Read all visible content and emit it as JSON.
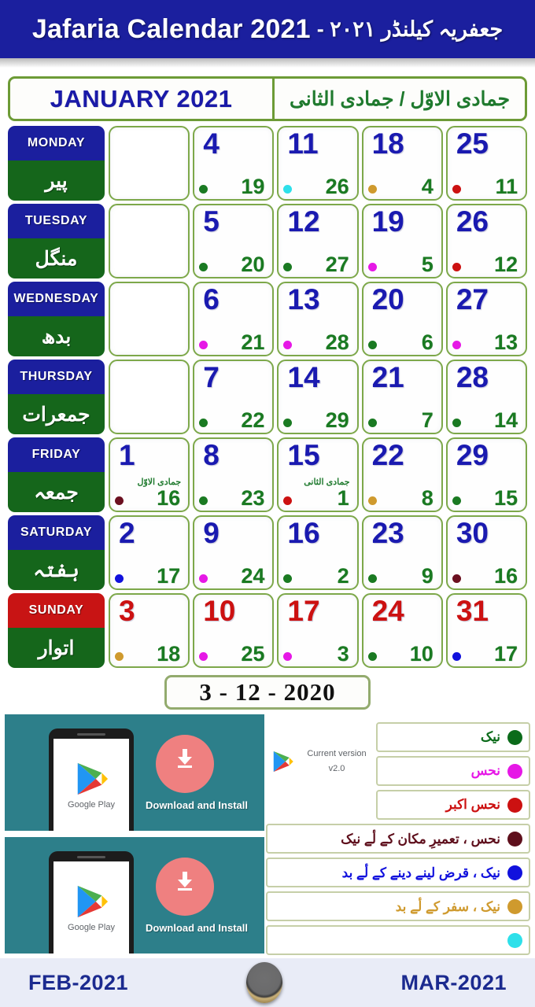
{
  "app": {
    "title_en": "Jafaria Calendar 2021",
    "title_ur": "جعفریہ کیلنڈر ۲۰۲۱ -"
  },
  "month_header": {
    "gregorian": "JANUARY 2021",
    "hijri": "جمادى الاوّل / جمادى الثانى"
  },
  "days": [
    {
      "en": "MONDAY",
      "ur": "پیر"
    },
    {
      "en": "TUESDAY",
      "ur": "منگل"
    },
    {
      "en": "WEDNESDAY",
      "ur": "بدھ"
    },
    {
      "en": "THURSDAY",
      "ur": "جمعرات"
    },
    {
      "en": "FRIDAY",
      "ur": "جمعہ"
    },
    {
      "en": "SATURDAY",
      "ur": "ہفتہ"
    },
    {
      "en": "SUNDAY",
      "ur": "اتوار"
    }
  ],
  "colors": {
    "title_bar": "#1b1f9e",
    "day_en_bg": "#1b1f9e",
    "day_en_sunday_bg": "#c81414",
    "day_ur_bg": "#15661b",
    "cell_border": "#7da84a",
    "gregorian_num": "#1a1ab0",
    "sunday_num": "#cc1111",
    "hijri_num": "#1a7a22",
    "banner_bg": "#2d7f8a",
    "bottom_nav_bg": "#e9ecf7"
  },
  "weeks": [
    {
      "day": "MONDAY",
      "cells": [
        {
          "empty": true
        },
        {
          "g": "4",
          "h": "19",
          "dot": "#1a7a22"
        },
        {
          "g": "11",
          "h": "26",
          "dot": "#2ee0ea"
        },
        {
          "g": "18",
          "h": "4",
          "dot": "#cf9a2e"
        },
        {
          "g": "25",
          "h": "11",
          "dot": "#cc1111"
        }
      ]
    },
    {
      "day": "TUESDAY",
      "cells": [
        {
          "empty": true
        },
        {
          "g": "5",
          "h": "20",
          "dot": "#1a7a22"
        },
        {
          "g": "12",
          "h": "27",
          "dot": "#1a7a22"
        },
        {
          "g": "19",
          "h": "5",
          "dot": "#e618e6"
        },
        {
          "g": "26",
          "h": "12",
          "dot": "#cc1111"
        }
      ]
    },
    {
      "day": "WEDNESDAY",
      "cells": [
        {
          "empty": true
        },
        {
          "g": "6",
          "h": "21",
          "dot": "#e618e6"
        },
        {
          "g": "13",
          "h": "28",
          "dot": "#e618e6"
        },
        {
          "g": "20",
          "h": "6",
          "dot": "#1a7a22"
        },
        {
          "g": "27",
          "h": "13",
          "dot": "#e618e6"
        }
      ]
    },
    {
      "day": "THURSDAY",
      "cells": [
        {
          "empty": true
        },
        {
          "g": "7",
          "h": "22",
          "dot": "#1a7a22"
        },
        {
          "g": "14",
          "h": "29",
          "dot": "#1a7a22"
        },
        {
          "g": "21",
          "h": "7",
          "dot": "#1a7a22"
        },
        {
          "g": "28",
          "h": "14",
          "dot": "#1a7a22"
        }
      ]
    },
    {
      "day": "FRIDAY",
      "cells": [
        {
          "g": "1",
          "h": "16",
          "dot": "#6b1020",
          "hmonth": "جمادى الاوّل"
        },
        {
          "g": "8",
          "h": "23",
          "dot": "#1a7a22"
        },
        {
          "g": "15",
          "h": "1",
          "dot": "#cc1111",
          "hmonth": "جمادى الثانى"
        },
        {
          "g": "22",
          "h": "8",
          "dot": "#cf9a2e"
        },
        {
          "g": "29",
          "h": "15",
          "dot": "#1a7a22"
        }
      ]
    },
    {
      "day": "SATURDAY",
      "cells": [
        {
          "g": "2",
          "h": "17",
          "dot": "#1111dd"
        },
        {
          "g": "9",
          "h": "24",
          "dot": "#e618e6"
        },
        {
          "g": "16",
          "h": "2",
          "dot": "#1a7a22"
        },
        {
          "g": "23",
          "h": "9",
          "dot": "#1a7a22"
        },
        {
          "g": "30",
          "h": "16",
          "dot": "#6b1020"
        }
      ]
    },
    {
      "day": "SUNDAY",
      "sunday": true,
      "cells": [
        {
          "g": "3",
          "h": "18",
          "dot": "#cf9a2e"
        },
        {
          "g": "10",
          "h": "25",
          "dot": "#e618e6"
        },
        {
          "g": "17",
          "h": "3",
          "dot": "#e618e6"
        },
        {
          "g": "24",
          "h": "10",
          "dot": "#1a7a22"
        },
        {
          "g": "31",
          "h": "17",
          "dot": "#1111dd"
        }
      ]
    }
  ],
  "today_box": "3 - 12 - 2020",
  "banner": {
    "gplay_label": "Google Play",
    "cta": "Download and Install"
  },
  "version": {
    "line1": "Current version",
    "line2": "v2.0"
  },
  "legend": [
    {
      "label": "نیک",
      "dot": "#0b6b1a",
      "text_color": "#0b6b1a",
      "size": "short"
    },
    {
      "label": "نحس",
      "dot": "#e618e6",
      "text_color": "#e618e6",
      "size": "short"
    },
    {
      "label": "نحس اکبر",
      "dot": "#cc1111",
      "text_color": "#cc1111",
      "size": "short"
    },
    {
      "label": "نحس ، تعمیرِ مکان کے لٔے نیک",
      "dot": "#5e0f1c",
      "text_color": "#5e0f1c",
      "size": "long"
    },
    {
      "label": "نیک ، قرض لینے دینے کے لٔے بد",
      "dot": "#1111dd",
      "text_color": "#1111dd",
      "size": "long"
    },
    {
      "label": "نیک ، سفر کے لٔے بد",
      "dot": "#cf9a2e",
      "text_color": "#cf9a2e",
      "size": "long"
    },
    {
      "label": "",
      "dot": "#2ee0ea",
      "text_color": "#2ee0ea",
      "size": "long"
    }
  ],
  "bottom_nav": {
    "prev": "FEB-2021",
    "next": "MAR-2021",
    "home_icon": "home-button"
  }
}
